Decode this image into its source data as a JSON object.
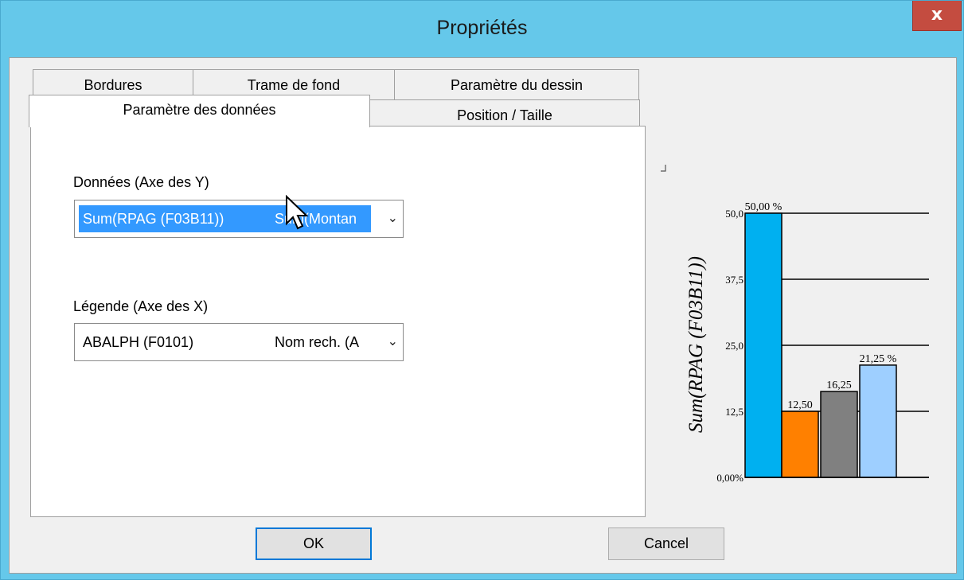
{
  "window": {
    "title": "Propriétés",
    "close_glyph": "x"
  },
  "tabs": {
    "back_row": [
      "Bordures",
      "Trame de fond",
      "Paramètre du dessin"
    ],
    "front_row": [
      "Paramètre des données",
      "Position / Taille"
    ],
    "active": "Paramètre des données"
  },
  "panel": {
    "y_axis_label": "Données (Axe des Y)",
    "y_axis_select": {
      "col1": "Sum(RPAG (F03B11))",
      "col2": "Sum(Montan",
      "highlighted": true
    },
    "x_axis_label": "Légende (Axe des X)",
    "x_axis_select": {
      "col1": "ABALPH (F0101)",
      "col2": "Nom rech. (A",
      "highlighted": false
    }
  },
  "buttons": {
    "ok": "OK",
    "cancel": "Cancel"
  },
  "chart_data": {
    "type": "bar",
    "categories": [
      "",
      "",
      "",
      ""
    ],
    "values": [
      50.0,
      12.5,
      16.25,
      21.25
    ],
    "colors": [
      "#00b0f0",
      "#ff8000",
      "#808080",
      "#9ecfff"
    ],
    "data_labels": [
      "50,00 %",
      "12,50",
      "16,25",
      "21,25 %"
    ],
    "yticks": [
      "0,00%",
      "12,5",
      "25,0",
      "37,5",
      "50,0"
    ],
    "ytick_values": [
      0,
      12.5,
      25,
      37.5,
      50
    ],
    "ylim": [
      0,
      50
    ],
    "xlabel": "ABALPH (F0101)",
    "ylabel": "Sum(RPAG (F03B11))",
    "grid": true
  }
}
